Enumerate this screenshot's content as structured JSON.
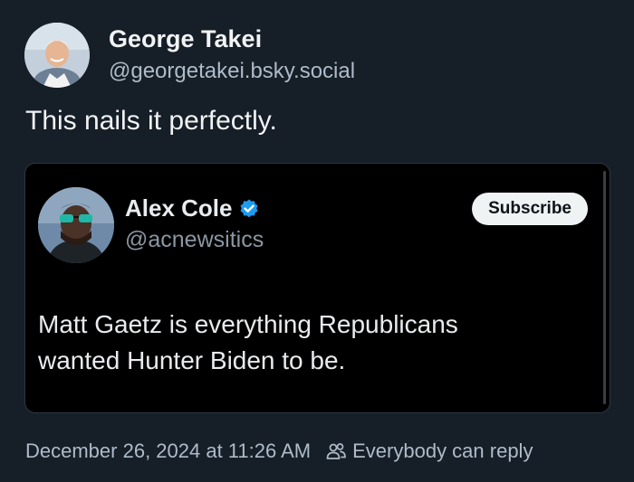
{
  "post": {
    "author": {
      "name": "George Takei",
      "handle": "@georgetakei.bsky.social",
      "avatar_icon": "avatar"
    },
    "text": "This nails it perfectly.",
    "embed": {
      "author": {
        "name": "Alex Cole",
        "handle": "@acnewsitics",
        "verified": true,
        "verified_icon": "verified-badge-icon",
        "verified_color": "#1d9bf0"
      },
      "subscribe_label": "Subscribe",
      "text_lines": [
        "Matt Gaetz is everything Republicans",
        "wanted Hunter Biden to be."
      ]
    },
    "footer": {
      "timestamp": "December 26, 2024 at 11:26 AM",
      "reply_icon": "people-icon",
      "reply_setting": "Everybody can reply"
    }
  },
  "colors": {
    "background": "#161e27",
    "embed_background": "#000000",
    "text_primary": "#f1f3f5",
    "text_secondary": "#aebbc9"
  }
}
